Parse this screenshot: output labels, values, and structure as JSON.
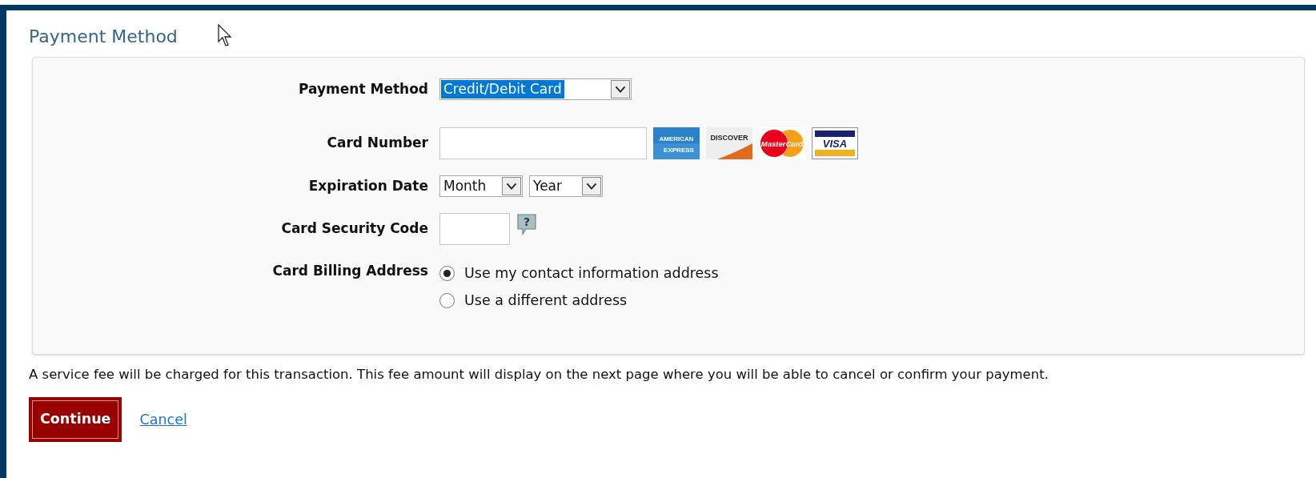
{
  "title": "Payment Method",
  "form": {
    "payment_method": {
      "label": "Payment Method",
      "value": "Credit/Debit Card",
      "focused": true
    },
    "card_number": {
      "label": "Card Number"
    },
    "card_logos": [
      {
        "kind": "amex",
        "texts": [
          "AMERICAN",
          "EXPRESS"
        ]
      },
      {
        "kind": "discover",
        "texts": [
          "DISCOVER"
        ]
      },
      {
        "kind": "mastercard",
        "texts": [
          "MasterCard"
        ]
      },
      {
        "kind": "visa",
        "texts": [
          "VISA"
        ]
      }
    ],
    "expiration": {
      "label": "Expiration Date",
      "month": "Month",
      "year": "Year"
    },
    "security_code": {
      "label": "Card Security Code",
      "help": "?"
    },
    "billing": {
      "label": "Card Billing Address",
      "options": [
        {
          "label": "Use my contact information address",
          "selected": true
        },
        {
          "label": "Use a different address",
          "selected": false
        }
      ]
    }
  },
  "notice": "A service fee will be charged for this transaction. This fee amount will display on the next page where you will be able to cancel or confirm your payment.",
  "buttons": {
    "continue": "Continue",
    "cancel": "Cancel"
  }
}
